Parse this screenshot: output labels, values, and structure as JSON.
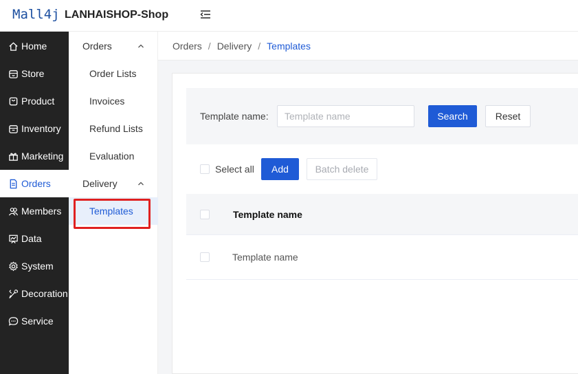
{
  "header": {
    "logo": "Mall4j",
    "shop_name": "LANHAISHOP-Shop"
  },
  "sidebar": {
    "items": [
      {
        "label": "Home",
        "icon": "home-icon"
      },
      {
        "label": "Store",
        "icon": "store-icon"
      },
      {
        "label": "Product",
        "icon": "product-icon"
      },
      {
        "label": "Inventory",
        "icon": "inventory-icon"
      },
      {
        "label": "Marketing",
        "icon": "gift-icon"
      },
      {
        "label": "Orders",
        "icon": "document-icon",
        "active": true
      },
      {
        "label": "Members",
        "icon": "members-icon"
      },
      {
        "label": "Data",
        "icon": "chart-icon"
      },
      {
        "label": "System",
        "icon": "gear-icon"
      },
      {
        "label": "Decoration",
        "icon": "brush-icon"
      },
      {
        "label": "Service",
        "icon": "chat-icon"
      }
    ]
  },
  "submenu": {
    "orders_group": "Orders",
    "order_items": [
      "Order Lists",
      "Invoices",
      "Refund Lists",
      "Evaluation"
    ],
    "delivery_group": "Delivery",
    "delivery_items": [
      "Templates"
    ]
  },
  "breadcrumb": [
    "Orders",
    "Delivery",
    "Templates"
  ],
  "search": {
    "label": "Template name:",
    "placeholder": "Template name",
    "value": "",
    "search_button": "Search",
    "reset_button": "Reset"
  },
  "toolbar": {
    "select_all": "Select all",
    "add_button": "Add",
    "batch_delete_button": "Batch delete"
  },
  "table": {
    "columns": [
      "Template name"
    ],
    "rows": [
      [
        "Template name"
      ]
    ]
  },
  "colors": {
    "accent": "#1f5bd6",
    "sidebar_bg": "#232323",
    "highlight": "#e02020"
  }
}
